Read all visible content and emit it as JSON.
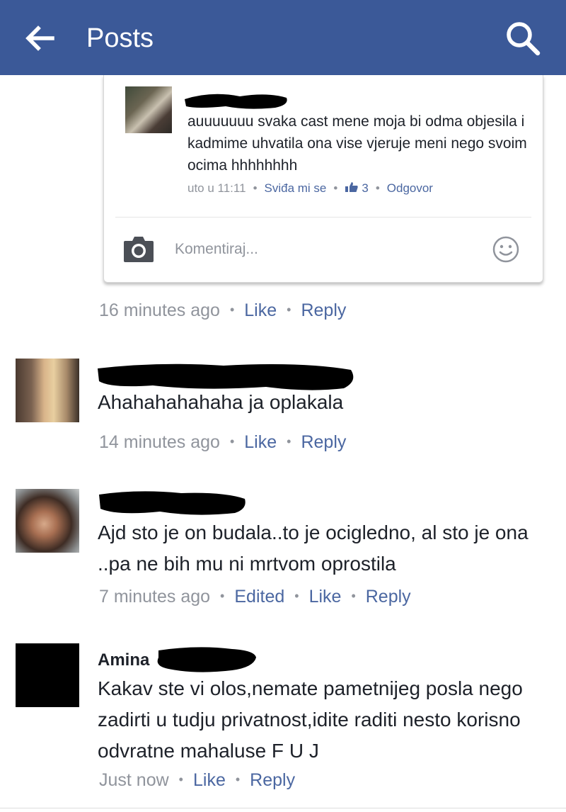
{
  "header": {
    "title": "Posts",
    "back_icon": "arrow-left-icon",
    "search_icon": "search-icon",
    "bar_color": "#3b5998"
  },
  "nested_reply": {
    "text_partial": "auuuuuuu",
    "text": "svaka cast mene moja bi odma objesila i kadmime uhvatila ona vise vjeruje meni nego svoim ocima hhhhhhhh",
    "time": "uto u 11:11",
    "like_label": "Sviđa mi se",
    "likes_count": "3",
    "reply_label": "Odgovor"
  },
  "comment_box": {
    "placeholder": "Komentiraj...",
    "camera_icon": "camera-icon",
    "emoji_icon": "smiley-icon"
  },
  "thread_meta": {
    "time": "16 minutes ago",
    "like": "Like",
    "reply": "Reply"
  },
  "comments": [
    {
      "text": "Ahahahahahaha ja oplakala",
      "time": "14 minutes ago",
      "like": "Like",
      "reply": "Reply"
    },
    {
      "text": "Ajd sto je on budala..to je ocigledno, al sto je ona ..pa ne bih mu ni mrtvom oprostila",
      "time": "7 minutes ago",
      "edited": "Edited",
      "like": "Like",
      "reply": "Reply"
    },
    {
      "name": "Amina",
      "text": "Kakav ste vi olos,nemate pametnijeg posla nego zadirti u tudju privatnost,idite raditi nesto korisno odvratne mahaluse F U J",
      "time": "Just now",
      "like": "Like",
      "reply": "Reply"
    }
  ],
  "colors": {
    "link": "#4b67a1",
    "muted": "#90949c",
    "text": "#1d2129"
  }
}
